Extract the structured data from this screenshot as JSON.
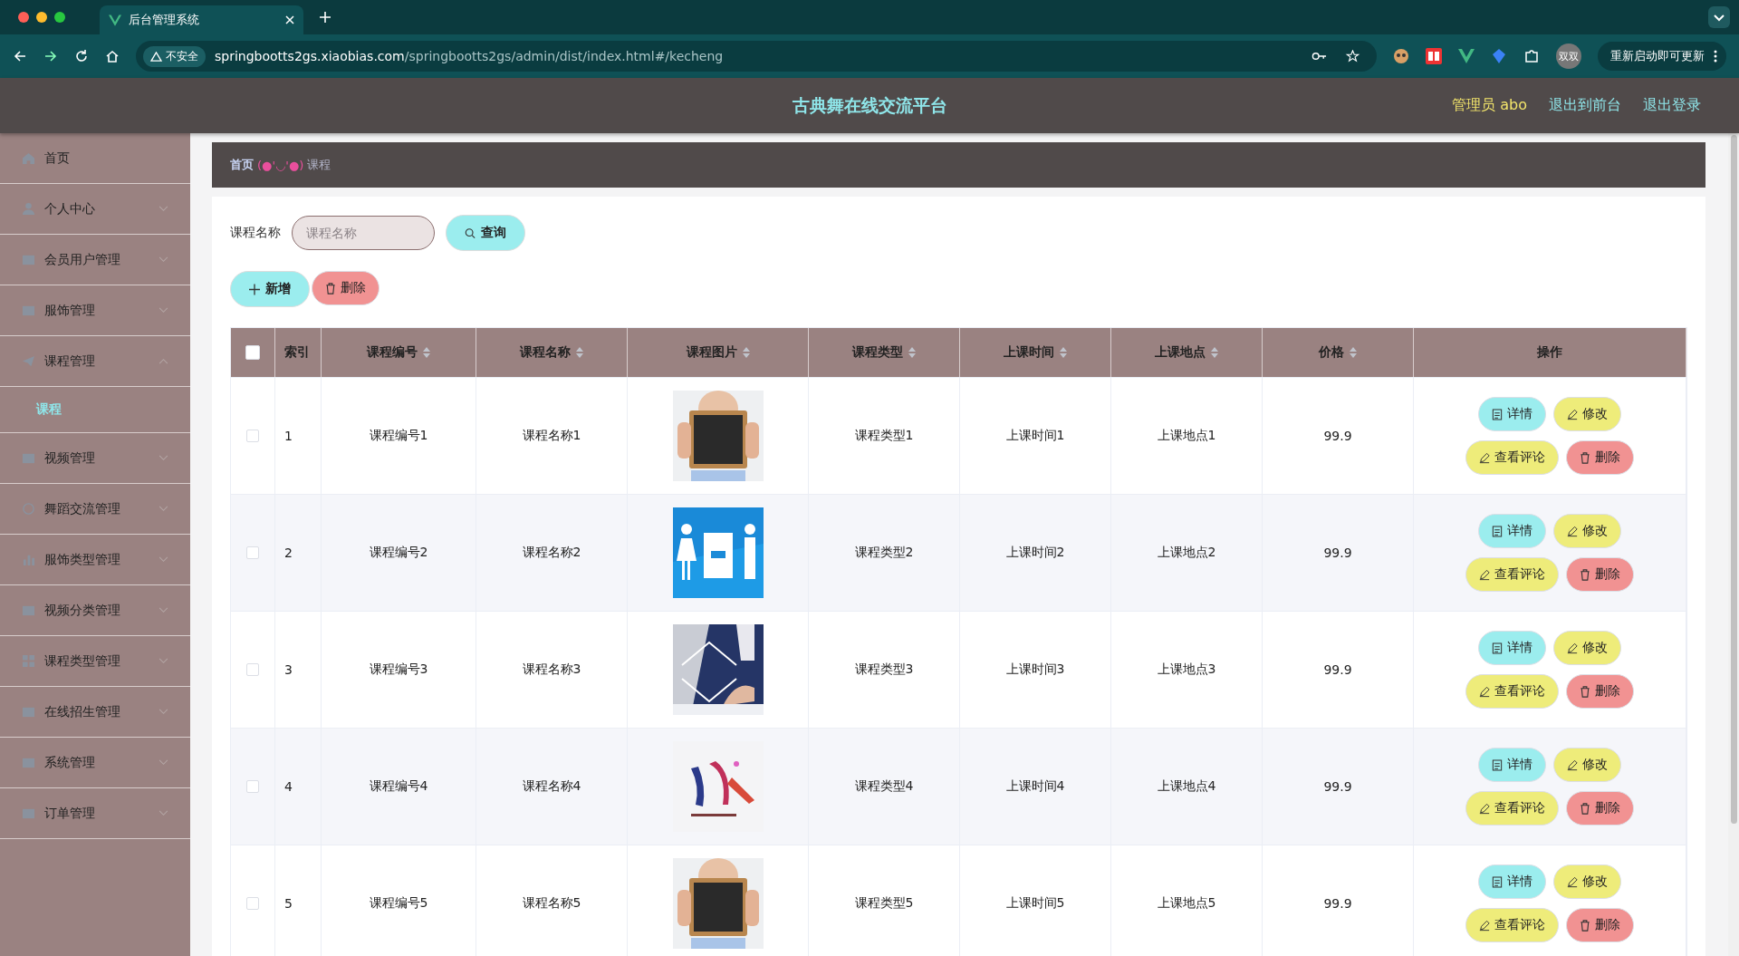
{
  "browser": {
    "tab_title": "后台管理系统",
    "security": "不安全",
    "url_host": "springbootts2gs.xiaobias.com",
    "url_path": "/springbootts2gs/admin/dist/index.html#/kecheng",
    "profile": "双双",
    "update_button": "重新启动即可更新"
  },
  "header": {
    "title": "古典舞在线交流平台",
    "user": "管理员 abo",
    "links": [
      "退出到前台",
      "退出登录"
    ]
  },
  "sidebar": {
    "items": [
      {
        "label": "首页"
      },
      {
        "label": "个人中心",
        "expanded": false
      },
      {
        "label": "会员用户管理",
        "expanded": false
      },
      {
        "label": "服饰管理",
        "expanded": false
      },
      {
        "label": "课程管理",
        "expanded": true,
        "children": [
          {
            "label": "课程",
            "selected": true
          }
        ]
      },
      {
        "label": "视频管理",
        "expanded": false
      },
      {
        "label": "舞蹈交流管理",
        "expanded": false
      },
      {
        "label": "服饰类型管理",
        "expanded": false
      },
      {
        "label": "视频分类管理",
        "expanded": false
      },
      {
        "label": "课程类型管理",
        "expanded": false
      },
      {
        "label": "在线招生管理",
        "expanded": false
      },
      {
        "label": "系统管理",
        "expanded": false
      },
      {
        "label": "订单管理",
        "expanded": false
      }
    ]
  },
  "breadcrumb": {
    "home": "首页",
    "separator": "(●'◡'●)",
    "current": "课程"
  },
  "search": {
    "label": "课程名称",
    "placeholder": "课程名称",
    "button": "查询"
  },
  "actions": [
    {
      "label": "新增",
      "kind": "add"
    },
    {
      "label": "删除",
      "kind": "delete"
    }
  ],
  "table": {
    "columns": [
      {
        "label": "索引",
        "sortable": false
      },
      {
        "label": "课程编号",
        "sortable": true
      },
      {
        "label": "课程名称",
        "sortable": true
      },
      {
        "label": "课程图片",
        "sortable": true
      },
      {
        "label": "课程类型",
        "sortable": true
      },
      {
        "label": "上课时间",
        "sortable": true
      },
      {
        "label": "上课地点",
        "sortable": true
      },
      {
        "label": "价格",
        "sortable": true
      },
      {
        "label": "操作",
        "sortable": false
      }
    ],
    "all_checked": false,
    "rows": [
      {
        "checked": false,
        "index": "1",
        "code": "课程编号1",
        "name": "课程名称1",
        "picture": {
          "kind": "picture"
        },
        "type": "课程类型1",
        "time": "上课时间1",
        "place": "上课地点1",
        "price": "99.9",
        "actions": [
          {
            "label": "详情",
            "kind": "detail"
          },
          {
            "label": "修改",
            "kind": "edit"
          },
          {
            "label": "查看评论",
            "kind": "comments"
          },
          {
            "label": "删除",
            "kind": "delete"
          }
        ]
      },
      {
        "checked": false,
        "index": "2",
        "code": "课程编号2",
        "name": "课程名称2",
        "picture": {
          "kind": "picture"
        },
        "type": "课程类型2",
        "time": "上课时间2",
        "place": "上课地点2",
        "price": "99.9",
        "actions": [
          {
            "label": "详情",
            "kind": "detail"
          },
          {
            "label": "修改",
            "kind": "edit"
          },
          {
            "label": "查看评论",
            "kind": "comments"
          },
          {
            "label": "删除",
            "kind": "delete"
          }
        ]
      },
      {
        "checked": false,
        "index": "3",
        "code": "课程编号3",
        "name": "课程名称3",
        "picture": {
          "kind": "picture"
        },
        "type": "课程类型3",
        "time": "上课时间3",
        "place": "上课地点3",
        "price": "99.9",
        "actions": [
          {
            "label": "详情",
            "kind": "detail"
          },
          {
            "label": "修改",
            "kind": "edit"
          },
          {
            "label": "查看评论",
            "kind": "comments"
          },
          {
            "label": "删除",
            "kind": "delete"
          }
        ]
      },
      {
        "checked": false,
        "index": "4",
        "code": "课程编号4",
        "name": "课程名称4",
        "picture": {
          "kind": "picture"
        },
        "type": "课程类型4",
        "time": "上课时间4",
        "place": "上课地点4",
        "price": "99.9",
        "actions": [
          {
            "label": "详情",
            "kind": "detail"
          },
          {
            "label": "修改",
            "kind": "edit"
          },
          {
            "label": "查看评论",
            "kind": "comments"
          },
          {
            "label": "删除",
            "kind": "delete"
          }
        ]
      },
      {
        "checked": false,
        "index": "5",
        "code": "课程编号5",
        "name": "课程名称5",
        "picture": {
          "kind": "picture"
        },
        "type": "课程类型5",
        "time": "上课时间5",
        "place": "上课地点5",
        "price": "99.9",
        "actions": [
          {
            "label": "详情",
            "kind": "detail"
          },
          {
            "label": "修改",
            "kind": "edit"
          },
          {
            "label": "查看评论",
            "kind": "comments"
          },
          {
            "label": "删除",
            "kind": "delete"
          }
        ]
      }
    ]
  }
}
